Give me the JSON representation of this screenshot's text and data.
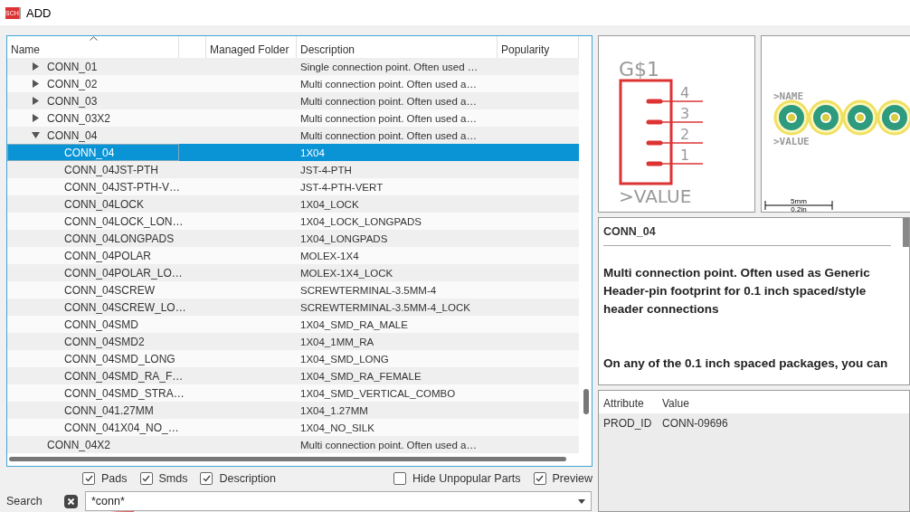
{
  "window": {
    "icon_label": "SCH",
    "title": "ADD"
  },
  "parts_table": {
    "columns": [
      "Name",
      "",
      "Managed Folder",
      "Description",
      "Popularity"
    ],
    "rows": [
      {
        "kind": "folder",
        "expanded": false,
        "selected": false,
        "name": "CONN_01",
        "description": "Single connection point. Often used …"
      },
      {
        "kind": "folder",
        "expanded": false,
        "selected": false,
        "name": "CONN_02",
        "description": "Multi connection point. Often used a…"
      },
      {
        "kind": "folder",
        "expanded": false,
        "selected": false,
        "name": "CONN_03",
        "description": "Multi connection point. Often used a…"
      },
      {
        "kind": "folder",
        "expanded": false,
        "selected": false,
        "name": "CONN_03X2",
        "description": "Multi connection point. Often used a…"
      },
      {
        "kind": "folder",
        "expanded": true,
        "selected": false,
        "name": "CONN_04",
        "description": "Multi connection point. Often used a…",
        "children": [
          {
            "name": "CONN_04",
            "description": "1X04",
            "selected": true
          },
          {
            "name": "CONN_04JST-PTH",
            "description": "JST-4-PTH",
            "selected": false
          },
          {
            "name": "CONN_04JST-PTH-V…",
            "description": "JST-4-PTH-VERT",
            "selected": false
          },
          {
            "name": "CONN_04LOCK",
            "description": "1X04_LOCK",
            "selected": false
          },
          {
            "name": "CONN_04LOCK_LON…",
            "description": "1X04_LOCK_LONGPADS",
            "selected": false
          },
          {
            "name": "CONN_04LONGPADS",
            "description": "1X04_LONGPADS",
            "selected": false
          },
          {
            "name": "CONN_04POLAR",
            "description": "MOLEX-1X4",
            "selected": false
          },
          {
            "name": "CONN_04POLAR_LO…",
            "description": "MOLEX-1X4_LOCK",
            "selected": false
          },
          {
            "name": "CONN_04SCREW",
            "description": "SCREWTERMINAL-3.5MM-4",
            "selected": false
          },
          {
            "name": "CONN_04SCREW_LO…",
            "description": "SCREWTERMINAL-3.5MM-4_LOCK",
            "selected": false
          },
          {
            "name": "CONN_04SMD",
            "description": "1X04_SMD_RA_MALE",
            "selected": false
          },
          {
            "name": "CONN_04SMD2",
            "description": "1X04_1MM_RA",
            "selected": false
          },
          {
            "name": "CONN_04SMD_LONG",
            "description": "1X04_SMD_LONG",
            "selected": false
          },
          {
            "name": "CONN_04SMD_RA_F…",
            "description": "1X04_SMD_RA_FEMALE",
            "selected": false
          },
          {
            "name": "CONN_04SMD_STRA…",
            "description": "1X04_SMD_VERTICAL_COMBO",
            "selected": false
          },
          {
            "name": "CONN_041.27MM",
            "description": "1X04_1.27MM",
            "selected": false
          },
          {
            "name": "CONN_041X04_NO_…",
            "description": "1X04_NO_SILK",
            "selected": false
          }
        ]
      },
      {
        "kind": "leaf",
        "selected": false,
        "name": "CONN_04X2",
        "description": "Multi connection point. Often used a…"
      }
    ]
  },
  "schematic_preview": {
    "designator": "G$1",
    "pins": [
      "4",
      "3",
      "2",
      "1"
    ],
    "value_label": ">VALUE"
  },
  "package_preview": {
    "name_label": ">NAME",
    "value_label": ">VALUE",
    "scale": [
      "5mm",
      "0.2in"
    ]
  },
  "description_panel": {
    "title": "CONN_04",
    "paragraphs": [
      "Multi connection point. Often used as Generic Header-pin footprint for 0.1 inch spaced/style header connections",
      "On any of the 0.1 inch spaced packages, you can"
    ]
  },
  "attributes": {
    "columns": [
      "Attribute",
      "Value"
    ],
    "rows": [
      [
        "PROD_ID",
        "CONN-09696"
      ]
    ]
  },
  "filters": [
    {
      "label": "Pads",
      "checked": true
    },
    {
      "label": "Smds",
      "checked": true
    },
    {
      "label": "Description",
      "checked": true
    },
    {
      "label": "Hide Unpopular Parts",
      "checked": false
    },
    {
      "label": "Preview",
      "checked": true
    }
  ],
  "search": {
    "label": "Search",
    "value": "*conn*"
  }
}
